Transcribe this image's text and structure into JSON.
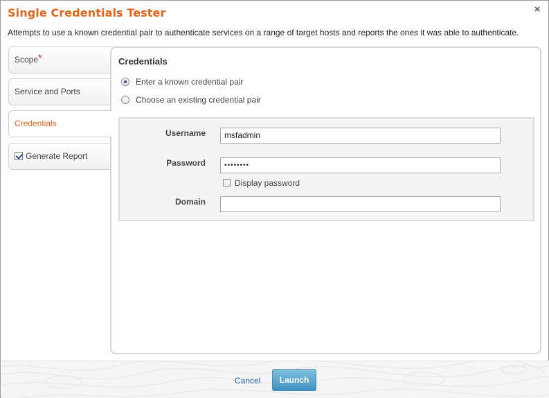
{
  "dialog": {
    "title": "Single Credentials Tester",
    "description": "Attempts to use a known credential pair to authenticate services on a range of target hosts and reports the ones it was able to authenticate.",
    "close_glyph": "×"
  },
  "tabs": [
    {
      "label": "Scope",
      "required_mark": "*",
      "active": false
    },
    {
      "label": "Service and Ports",
      "active": false
    },
    {
      "label": "Credentials",
      "active": true
    },
    {
      "label": "Generate Report",
      "checked": true,
      "active": false
    }
  ],
  "credentials": {
    "section_title": "Credentials",
    "options": [
      {
        "label": "Enter a known credential pair",
        "selected": true
      },
      {
        "label": "Choose an existing credential pair",
        "selected": false
      }
    ],
    "username_label": "Username",
    "username_value": "msfadmin",
    "password_label": "Password",
    "password_value": "••••••••",
    "display_password_label": "Display password",
    "domain_label": "Domain",
    "domain_value": ""
  },
  "footer": {
    "cancel_label": "Cancel",
    "launch_label": "Launch"
  },
  "colors": {
    "title": "#e0661b",
    "active_tab": "#e0661b",
    "required": "#cc2222",
    "link": "#1f5ea0",
    "launch_button": "#3f92bf"
  }
}
